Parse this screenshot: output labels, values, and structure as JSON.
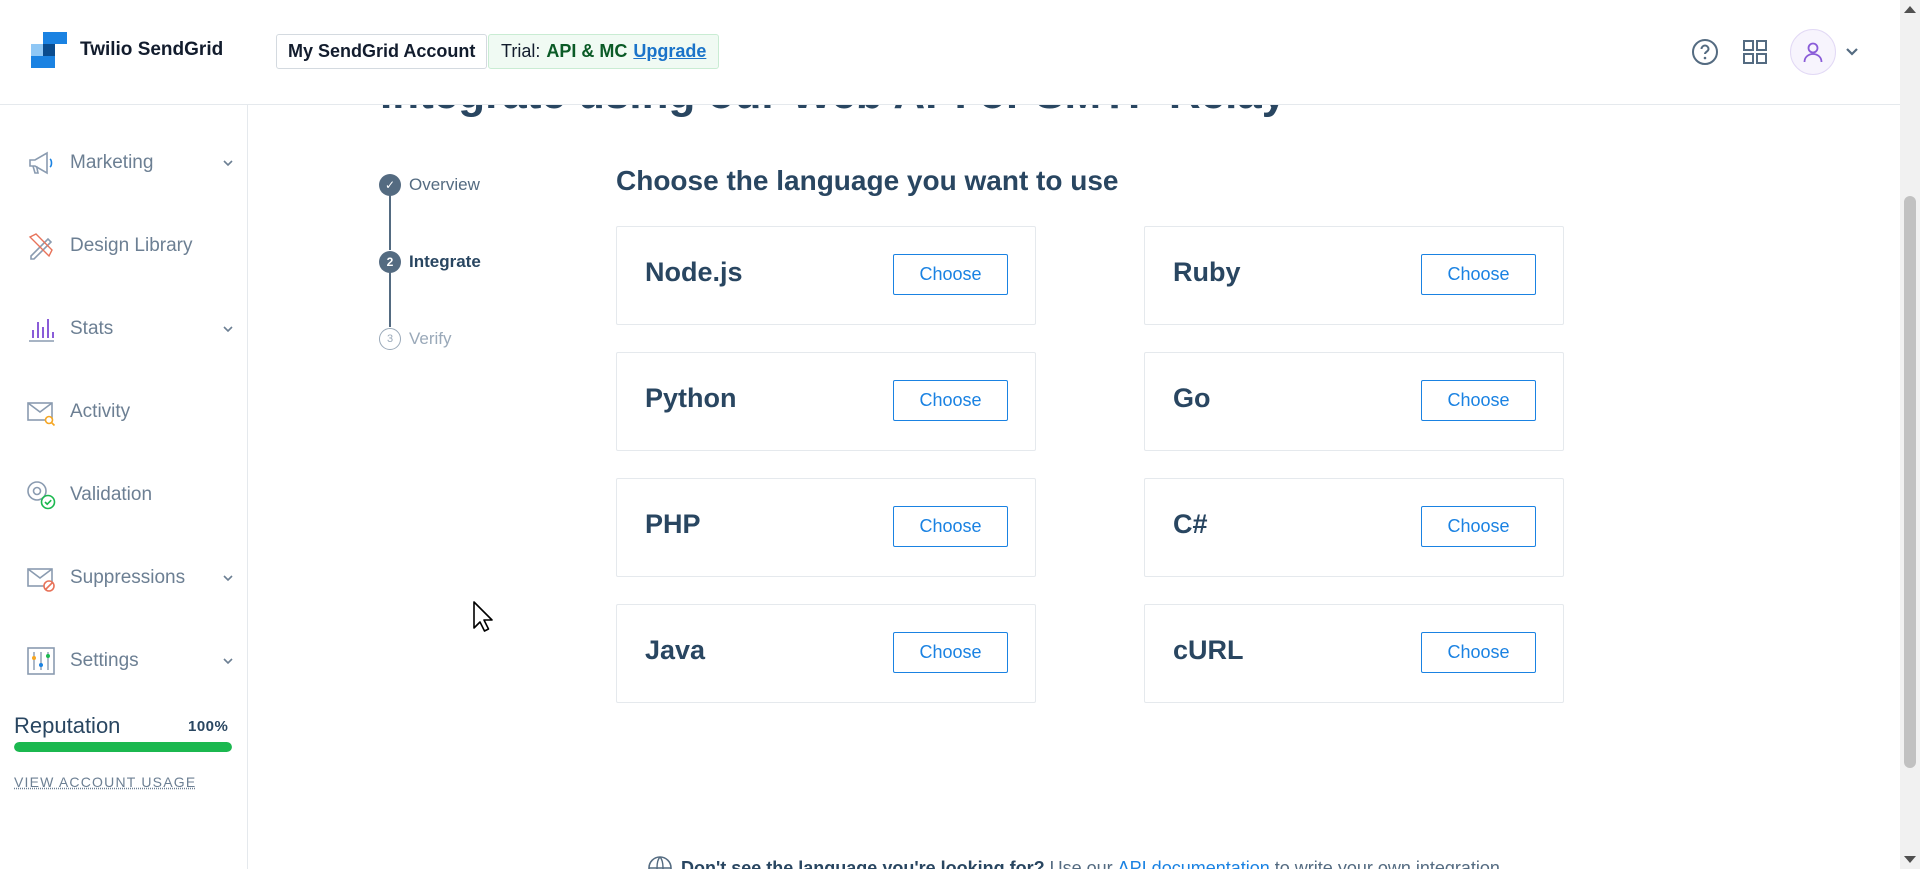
{
  "header": {
    "brand": "Twilio SendGrid",
    "account_button": "My SendGrid Account",
    "trial_prefix": "Trial:",
    "trial_plan": "API & MC",
    "trial_upgrade": "Upgrade",
    "icons": [
      "help-icon",
      "app-grid-icon",
      "user-avatar-icon",
      "chevron-down-icon"
    ]
  },
  "sidebar": {
    "items": [
      {
        "label": "Marketing",
        "icon": "megaphone-icon",
        "has_chevron": true
      },
      {
        "label": "Design Library",
        "icon": "design-tools-icon",
        "has_chevron": false
      },
      {
        "label": "Stats",
        "icon": "bar-chart-icon",
        "has_chevron": true
      },
      {
        "label": "Activity",
        "icon": "mail-search-icon",
        "has_chevron": false
      },
      {
        "label": "Validation",
        "icon": "at-check-icon",
        "has_chevron": false
      },
      {
        "label": "Suppressions",
        "icon": "mail-blocked-icon",
        "has_chevron": true
      },
      {
        "label": "Settings",
        "icon": "sliders-icon",
        "has_chevron": true
      }
    ],
    "reputation": {
      "label": "Reputation",
      "value": "100%",
      "fraction": 1.0
    },
    "usage_link": "VIEW ACCOUNT USAGE"
  },
  "main": {
    "partial_title": "Integrate using our Web API or SMTP Relay",
    "steps": [
      {
        "number": "✓",
        "label": "Overview",
        "state": "done"
      },
      {
        "number": "2",
        "label": "Integrate",
        "state": "active"
      },
      {
        "number": "3",
        "label": "Verify",
        "state": "pending"
      }
    ],
    "choose_title": "Choose the language you want to use",
    "languages": [
      "Node.js",
      "Ruby",
      "Python",
      "Go",
      "PHP",
      "C#",
      "Java",
      "cURL"
    ],
    "choose_label": "Choose",
    "note": {
      "bold": "Don't see the language you're looking for?",
      "before_link": "Use our",
      "link": "API documentation",
      "after_link": "to write your own integration."
    }
  },
  "colors": {
    "primary_blue": "#1a82e2",
    "navy_text": "#294661",
    "muted_text": "#6c7f93",
    "reputation_green": "#1bb84f"
  }
}
